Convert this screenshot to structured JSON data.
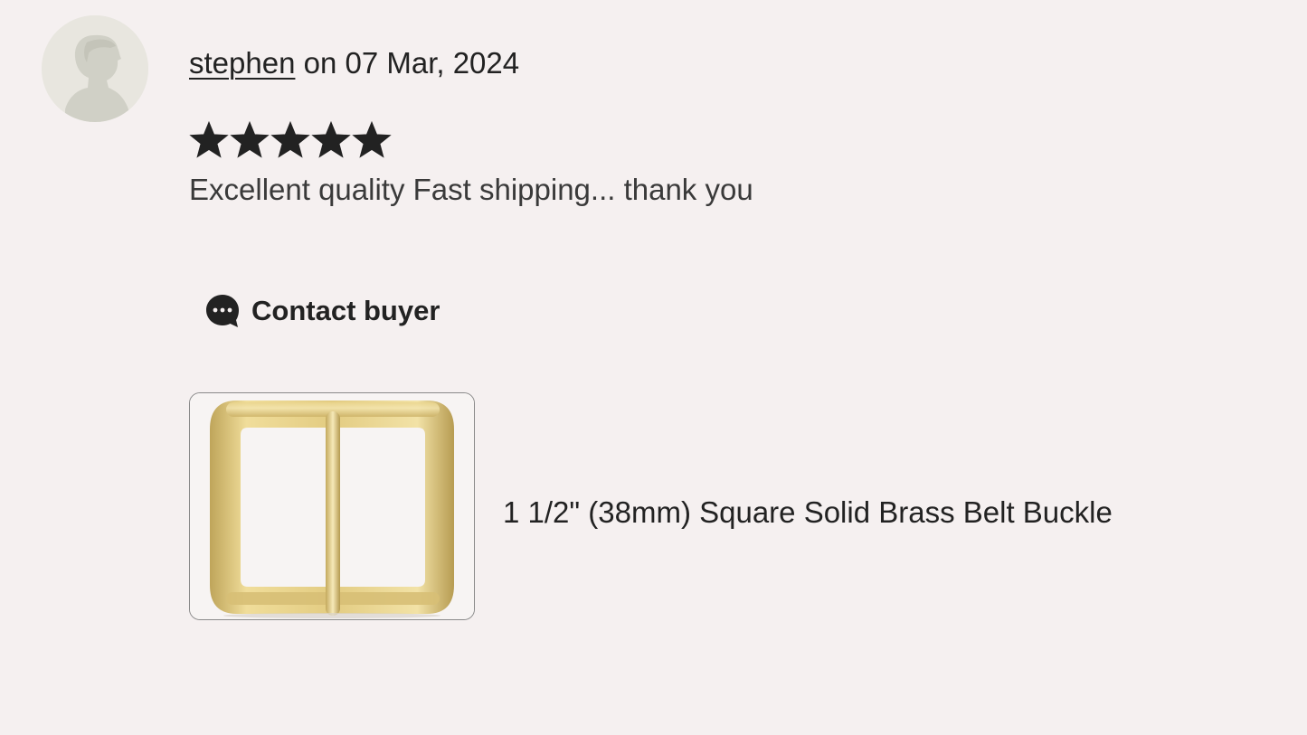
{
  "review": {
    "reviewer_name": "stephen",
    "date_text": " on 07 Mar, 2024",
    "rating": 5,
    "rating_max": 5,
    "text": "Excellent quality Fast shipping... thank you"
  },
  "actions": {
    "contact_label": "Contact buyer",
    "contact_icon": "chat-bubble-icon"
  },
  "product": {
    "title": "1 1/2\" (38mm) Square Solid Brass Belt Buckle",
    "image_icon": "belt-buckle-image"
  },
  "colors": {
    "background": "#f5f0f0",
    "text": "#222222",
    "star": "#222222",
    "brass": "#d9c27a"
  }
}
